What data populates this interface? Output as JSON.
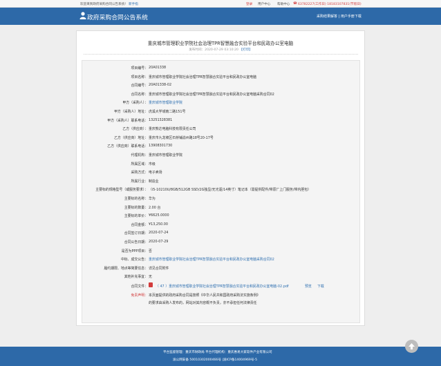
{
  "topbar": {
    "welcome": "欢迎来到政府采购合同公告系统!",
    "guide": "新手指",
    "login": "登录",
    "user_center": "用户中心",
    "help_center": "帮助中心",
    "phone": "63782227(工作日)  18183107831(节假日)"
  },
  "header": {
    "title": "政府采购合同公告系统",
    "link_rules": "采购结果解答",
    "link_download": "用户手册下载"
  },
  "notice": {
    "title": "重庆城市管理职业学院社会治理TPR智慧融合实验平台和民政办公室电脑",
    "pub_label": "发布时间：2020-07-29 03:10:20",
    "print": "【打印】"
  },
  "fields": [
    {
      "label": "项目编号：",
      "value": "20A01338"
    },
    {
      "label": "项目名称：",
      "value": "重庆城市管理职业学院社会治理TPR智慧融合实验平台和民政办公室电脑"
    },
    {
      "label": "合同编号：",
      "value": "20A01338-02"
    },
    {
      "label": "合同名称：",
      "value": "重庆城市管理职业学院社会治理TPR智慧融合实验平台和民政办公室电脑采购合同02"
    },
    {
      "label": "甲方（采购人）：",
      "value": "重庆城市管理职业学院"
    },
    {
      "label": "甲方（采购人）地址：",
      "value": "虎溪大学城南二路151号"
    },
    {
      "label": "甲方（采购人）联系电话：",
      "value": "13251328381"
    },
    {
      "label": "乙方（供应商）：",
      "value": "重庆熊达电脑科技有限责任公司"
    },
    {
      "label": "乙方（供应商）地址：",
      "value": "重庆市九龙坡区石桥铺渝州路18号20-17号"
    },
    {
      "label": "乙方（供应商）联系电话：",
      "value": "13908301730"
    },
    {
      "label": "代理机构：",
      "value": "重庆城市管理职业学院"
    },
    {
      "label": "所属区域：",
      "value": "市级"
    },
    {
      "label": "采购方式：",
      "value": "电子卖场"
    },
    {
      "label": "所属行业：",
      "value": "制造业"
    },
    {
      "label": "主要标的规格型号（或服务要求）：",
      "value": "（i5-10210U/8GB/512GB SSD/2G独显/无光驱/14英寸）笔记本（需提供配件/带原厂上门服务/带内胆包）"
    },
    {
      "label": "主要标的名称：",
      "value": "华为"
    },
    {
      "label": "主要标的数量：",
      "value": "2.00 台"
    },
    {
      "label": "主要标的单价：",
      "value": "¥6625.0000"
    },
    {
      "label": "合同金额：",
      "value": "¥13,250.00"
    },
    {
      "label": "合同签订日期：",
      "value": "2020-07-24"
    },
    {
      "label": "合同公告日期：",
      "value": "2020-07-29"
    },
    {
      "label": "是否为PPP项目：",
      "value": "否"
    },
    {
      "label": "中标、成交公告：",
      "value": "重庆城市管理职业学院社会治理TPR智慧融合实验平台和民政办公室电脑采购合同02"
    },
    {
      "label": "履约期限、地点等简要信息：",
      "value": "详见合同附件"
    },
    {
      "label": "其他补充事宜：",
      "value": "无"
    }
  ],
  "attachment": {
    "label": "合同文件：",
    "filename": "（ 47 ）重庆城市管理职业学院社会治理TPR智慧融合实验平台和民政办公室电脑-02.pdf",
    "preview": "预览",
    "download": "下载"
  },
  "disclaimer": {
    "label": "免责声明：",
    "line1": "本页面提供的政府采购合同是按照《中华人民共和国政府采购法实施条例》",
    "line2": "的要求由采购人发布的，网站对其内容概不负责，亦不承担任何法律责任"
  },
  "footer": {
    "supervisor": "平台监督管理：重庆市财政局    平台代理机构：重庆惠易大家软件产业有限公司",
    "icp": "渝公网安备 50010302000466号    |渝ICP备14004969号-5"
  },
  "colors": {
    "header_blue": "#2d69a8",
    "link_blue": "#2e6fb0",
    "accent_red": "#d23c3c"
  }
}
